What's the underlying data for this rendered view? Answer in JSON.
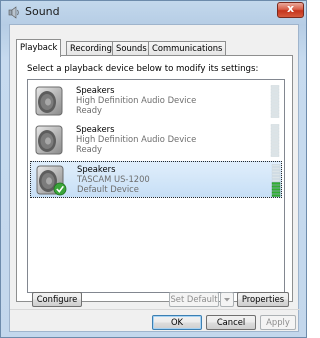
{
  "window": {
    "title": "Sound",
    "close_label": "x",
    "accent_color": "#c3d8ec"
  },
  "tabs": [
    {
      "label": "Playback",
      "active": true
    },
    {
      "label": "Recording",
      "active": false
    },
    {
      "label": "Sounds",
      "active": false
    },
    {
      "label": "Communications",
      "active": false
    }
  ],
  "instruction": "Select a playback device below to modify its settings:",
  "devices": [
    {
      "name": "Speakers",
      "description": "High Definition Audio Device",
      "status": "Ready",
      "selected": false,
      "default": false,
      "level": 0,
      "icon": "speaker-icon"
    },
    {
      "name": "Speakers",
      "description": "High Definition Audio Device",
      "status": "Ready",
      "selected": false,
      "default": false,
      "level": 0,
      "icon": "speaker-icon"
    },
    {
      "name": "Speakers",
      "description": "TASCAM US-1200",
      "status": "Default Device",
      "selected": true,
      "default": true,
      "level": 0.4,
      "icon": "speaker-icon"
    }
  ],
  "buttons": {
    "configure": {
      "label": "Configure",
      "accel": "C"
    },
    "set_default": {
      "label": "Set Default",
      "accel": "S",
      "enabled": false
    },
    "properties": {
      "label": "Properties",
      "accel": "P"
    },
    "ok": "OK",
    "cancel": "Cancel",
    "apply": "Apply"
  }
}
